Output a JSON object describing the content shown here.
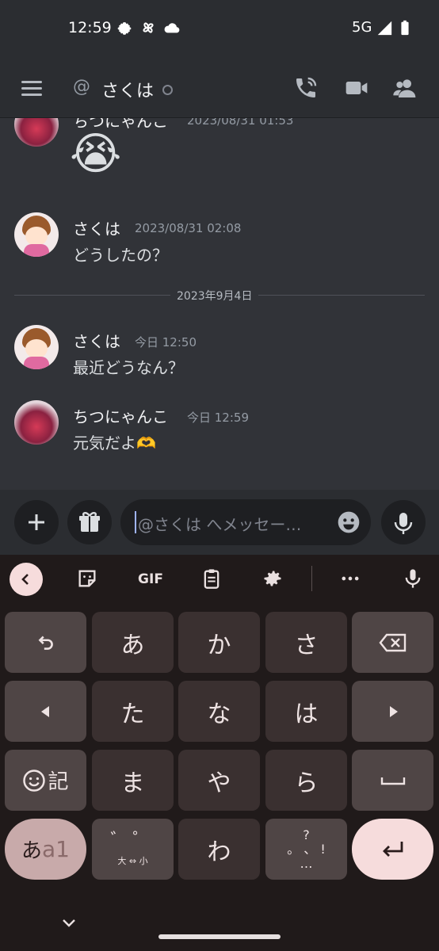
{
  "status_bar": {
    "time": "12:59",
    "network": "5G",
    "icons": [
      "gear-icon",
      "pinwheel-icon",
      "cloud-icon",
      "signal-icon",
      "battery-icon"
    ]
  },
  "header": {
    "at": "@",
    "title": "さくは",
    "icons": [
      "menu-icon",
      "call-icon",
      "video-icon",
      "members-icon"
    ]
  },
  "messages": [
    {
      "author": "ちつにゃんこ",
      "timestamp": "2023/08/31 01:53",
      "text": "😭",
      "partial": true
    },
    {
      "author": "さくは",
      "timestamp": "2023/08/31 02:08",
      "text": "どうしたの？"
    },
    {
      "author": "さくは",
      "timestamp": "今日 12:50",
      "text": "最近どうなん？"
    },
    {
      "author": "ちつにゃんこ",
      "timestamp": "今日 12:59",
      "text": "元気だよ🫶"
    }
  ],
  "date_divider": "2023年9月4日",
  "composer": {
    "placeholder": "@さくは へメッセー…"
  },
  "keyboard": {
    "toolbar": {
      "gif": "GIF"
    },
    "rows": [
      [
        "↶",
        "あ",
        "か",
        "さ",
        "⌫"
      ],
      [
        "◀",
        "た",
        "な",
        "は",
        "▶"
      ],
      [
        "☺記",
        "ま",
        "や",
        "ら",
        "␣"
      ],
      [
        "あa1",
        "゛゜ 大⇔小",
        "わ",
        "？。、！",
        "↵"
      ]
    ],
    "labels": {
      "a": "あ",
      "ka": "か",
      "sa": "さ",
      "ta": "た",
      "na": "な",
      "ha": "は",
      "ma": "ま",
      "ya": "や",
      "ra": "ら",
      "wa": "わ",
      "emoji_ki": "記",
      "mode_a": "あ",
      "mode_a1": "a1",
      "dakuten_bottom": "大 ⇔ 小",
      "punct_top": "?",
      "punct_mid": "。  、  !",
      "punct_bot": "…"
    }
  },
  "colors": {
    "bg": "#313338",
    "header": "#2b2d31",
    "keyboard": "#201a1a",
    "accent": "#f6dcdc"
  }
}
